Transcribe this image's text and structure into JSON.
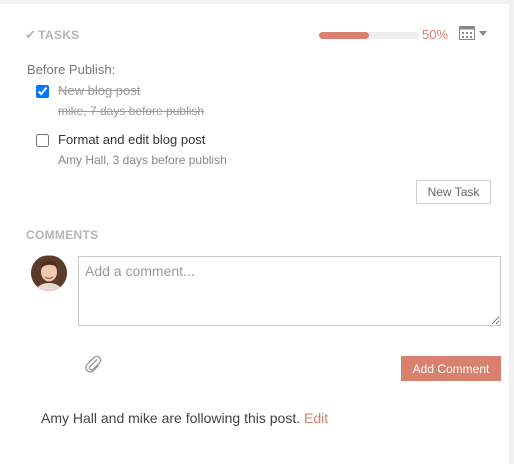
{
  "tasks": {
    "title": "TASKS",
    "progress_percent": 50,
    "progress_label": "50%",
    "group_label": "Before Publish:",
    "items": [
      {
        "title": "New blog post",
        "meta": "mike, 7 days before publish",
        "done": true
      },
      {
        "title": "Format and edit blog post",
        "meta": "Amy Hall, 3 days before publish",
        "done": false
      }
    ],
    "new_task_label": "New Task"
  },
  "comments": {
    "title": "COMMENTS",
    "placeholder": "Add a comment...",
    "add_label": "Add Comment"
  },
  "followers": {
    "text": "Amy Hall and mike are following this post.",
    "edit_label": "Edit"
  },
  "colors": {
    "accent": "#d9806f",
    "muted": "#b5b5b5"
  },
  "icons": {
    "tasks": "check-icon",
    "calendar": "calendar-icon",
    "attach": "paperclip-icon"
  }
}
